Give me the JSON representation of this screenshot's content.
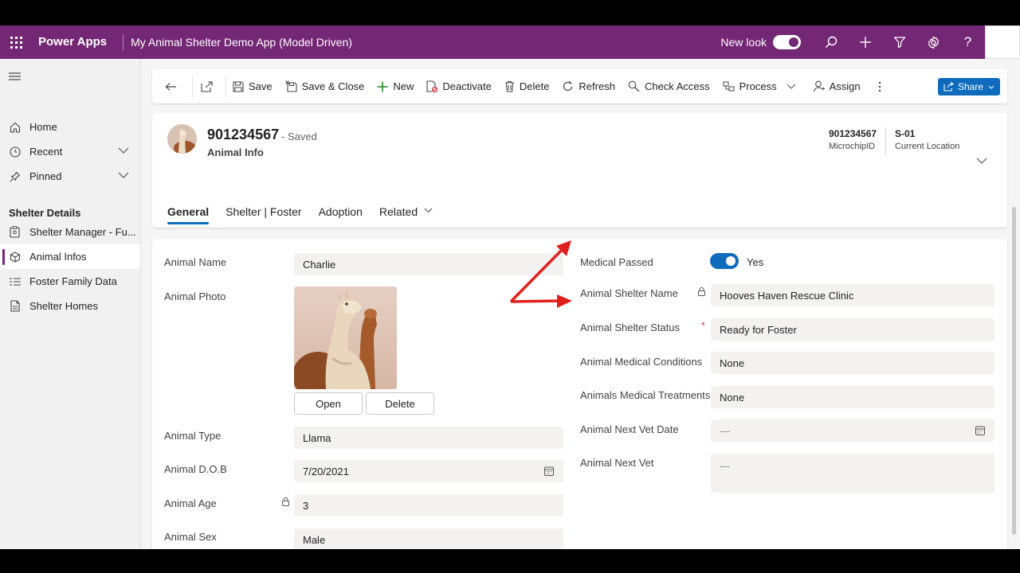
{
  "app": {
    "name": "Power Apps",
    "title": "My Animal Shelter Demo App (Model Driven)",
    "new_look_label": "New look",
    "brand_color": "#742774",
    "accent_color": "#0f6cbd"
  },
  "sidebar": {
    "items": [
      {
        "label": "Home",
        "icon": "home-icon"
      },
      {
        "label": "Recent",
        "icon": "clock-icon"
      },
      {
        "label": "Pinned",
        "icon": "pin-icon"
      }
    ],
    "group_title": "Shelter Details",
    "group_items": [
      {
        "label": "Shelter Manager - Fu...",
        "icon": "clipboard-icon"
      },
      {
        "label": "Animal Infos",
        "icon": "box-icon",
        "active": true
      },
      {
        "label": "Foster Family Data",
        "icon": "list-icon"
      },
      {
        "label": "Shelter Homes",
        "icon": "document-icon"
      }
    ]
  },
  "commands": {
    "save": "Save",
    "save_close": "Save & Close",
    "new": "New",
    "deactivate": "Deactivate",
    "delete": "Delete",
    "refresh": "Refresh",
    "check_access": "Check Access",
    "process": "Process",
    "assign": "Assign",
    "share": "Share"
  },
  "record": {
    "title": "901234567",
    "status": "- Saved",
    "entity": "Animal Info",
    "header_fields": [
      {
        "value": "901234567",
        "label": "MicrochipID"
      },
      {
        "value": "S-01",
        "label": "Current Location"
      }
    ]
  },
  "tabs": [
    "General",
    "Shelter | Foster",
    "Adoption",
    "Related"
  ],
  "form": {
    "left": {
      "animal_name": {
        "label": "Animal Name",
        "value": "Charlie"
      },
      "animal_photo": {
        "label": "Animal Photo",
        "open": "Open",
        "delete": "Delete"
      },
      "animal_type": {
        "label": "Animal Type",
        "value": "Llama"
      },
      "animal_dob": {
        "label": "Animal D.O.B",
        "value": "7/20/2021"
      },
      "animal_age": {
        "label": "Animal Age",
        "value": "3"
      },
      "animal_sex": {
        "label": "Animal Sex",
        "value": "Male"
      }
    },
    "right": {
      "medical_passed": {
        "label": "Medical Passed",
        "value": "Yes",
        "on": true
      },
      "shelter_name": {
        "label": "Animal Shelter Name",
        "value": "Hooves Haven Rescue Clinic"
      },
      "shelter_status": {
        "label": "Animal Shelter Status",
        "value": "Ready for Foster",
        "required_mark": "*"
      },
      "medical_conditions": {
        "label": "Animal Medical Conditions",
        "value": "None"
      },
      "medical_treatments": {
        "label": "Animals Medical Treatments",
        "value": "None"
      },
      "next_vet_date": {
        "label": "Animal Next Vet Date",
        "value": "---"
      },
      "next_vet": {
        "label": "Animal Next Vet",
        "value": "---"
      }
    }
  }
}
